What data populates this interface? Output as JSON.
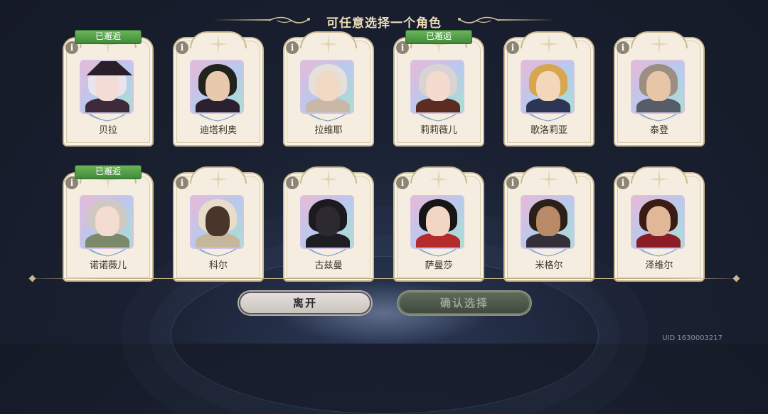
{
  "header": {
    "title": "可任意选择一个角色"
  },
  "cards": [
    {
      "name": "贝拉",
      "met": "已邂逅",
      "hair": "#e9e4ee",
      "skin": "#f4dcd6",
      "body": "#3d2a3a",
      "hat": true
    },
    {
      "name": "迪塔利奥",
      "met": "",
      "hair": "#20241d",
      "skin": "#e8c9ae",
      "body": "#2a2030"
    },
    {
      "name": "拉维耶",
      "met": "",
      "hair": "#e5e0da",
      "skin": "#f1d9c4",
      "body": "#c9b7a8"
    },
    {
      "name": "莉莉薇儿",
      "met": "已邂逅",
      "hair": "#d9d4d2",
      "skin": "#f3dccd",
      "body": "#5a2c22"
    },
    {
      "name": "歌洛莉亚",
      "met": "",
      "hair": "#d8a64e",
      "skin": "#f4d7bb",
      "body": "#2d3554"
    },
    {
      "name": "泰登",
      "met": "",
      "hair": "#9c8e80",
      "skin": "#e7c6a8",
      "body": "#575d68"
    },
    {
      "name": "诺诺薇儿",
      "met": "已邂逅",
      "hair": "#cfc9c2",
      "skin": "#f3dcd0",
      "body": "#7d8a6a"
    },
    {
      "name": "科尔",
      "met": "",
      "hair": "#e8dccb",
      "skin": "#4a352a",
      "body": "#c6b69c"
    },
    {
      "name": "古兹曼",
      "met": "",
      "hair": "#1a1a20",
      "skin": "#2c2a30",
      "body": "#1f1d24"
    },
    {
      "name": "萨曼莎",
      "met": "",
      "hair": "#161616",
      "skin": "#f1d6c4",
      "body": "#b52a2a"
    },
    {
      "name": "米格尔",
      "met": "",
      "hair": "#2b2018",
      "skin": "#b98a68",
      "body": "#34303a"
    },
    {
      "name": "泽维尔",
      "met": "",
      "hair": "#3a1c14",
      "skin": "#e0b898",
      "body": "#8a1d25"
    }
  ],
  "buttons": {
    "leave": "离开",
    "confirm": "确认选择"
  },
  "footer": {
    "uid": "UID 1630003217"
  },
  "colors": {
    "met_badge": "#4f9e45",
    "card_bg": "#f5eee0",
    "accent_gold": "#c8b48a"
  },
  "icons": {
    "info": "info-icon",
    "star": "sparkle-star-icon",
    "leaves": "leaf-ornament-icon"
  }
}
